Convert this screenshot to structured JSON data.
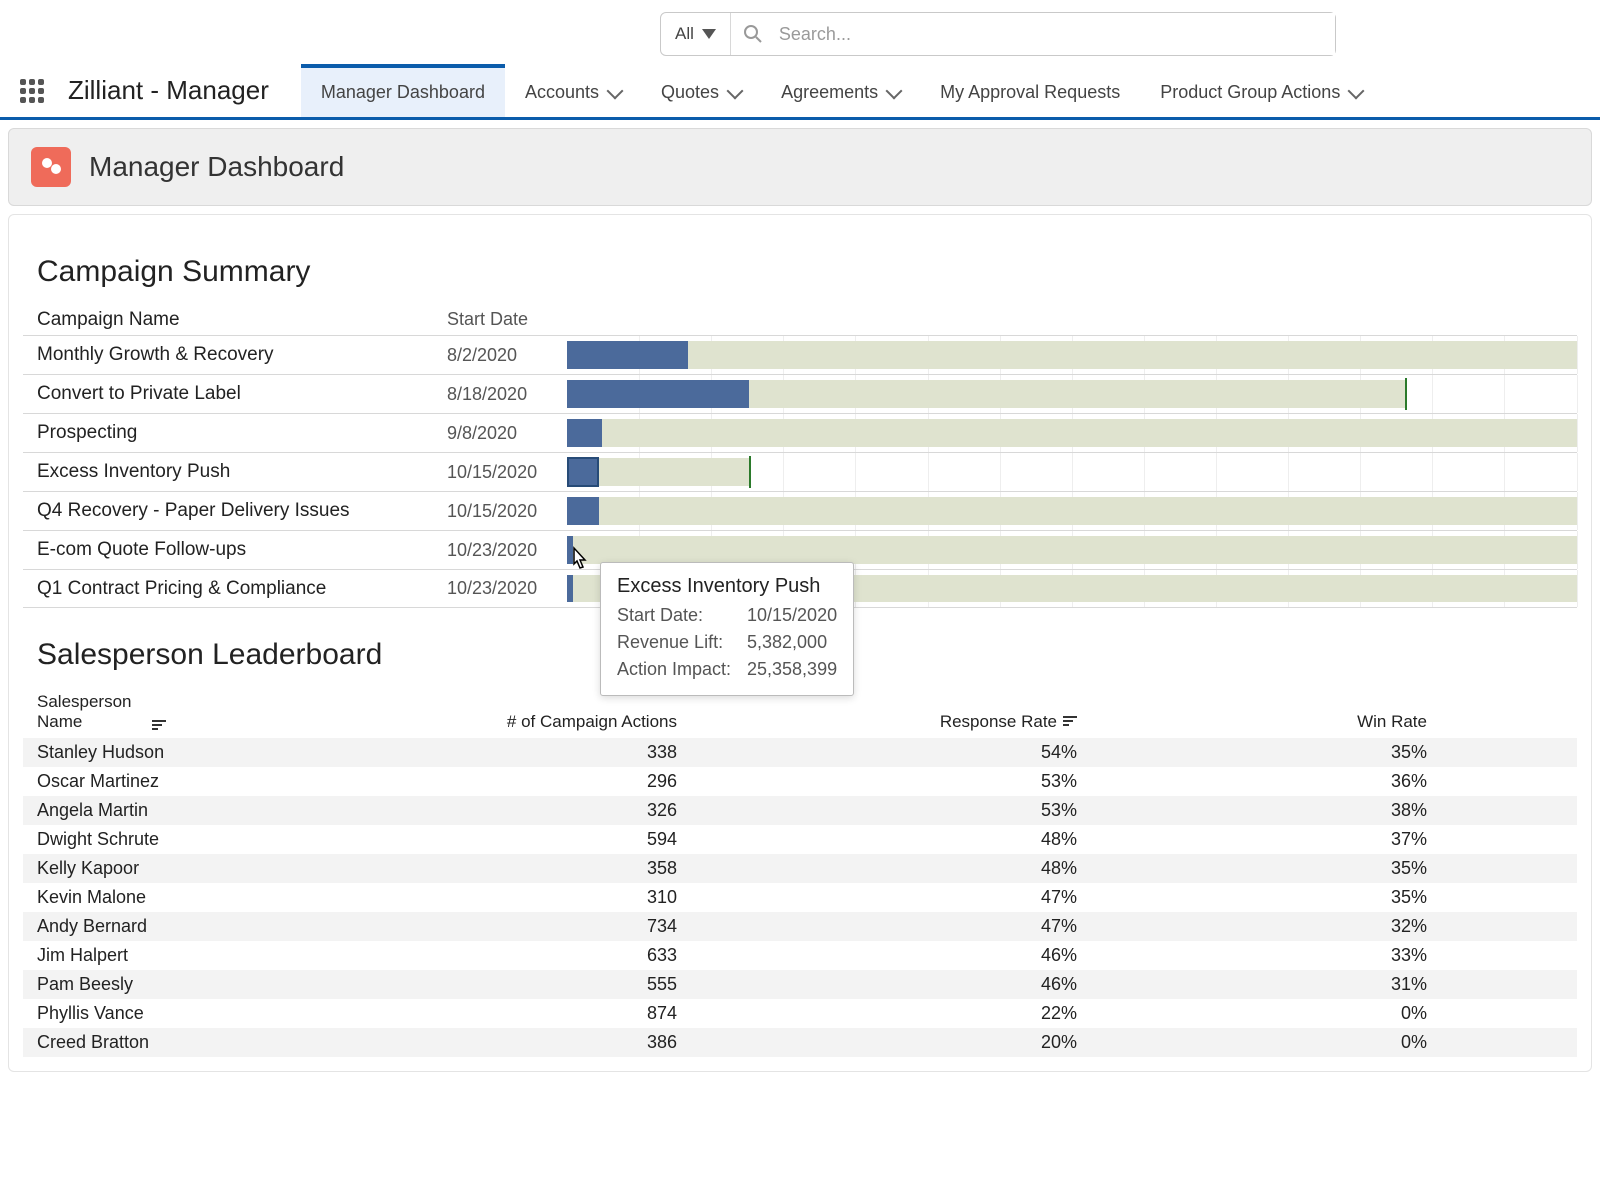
{
  "search": {
    "filter_label": "All",
    "placeholder": "Search..."
  },
  "app_name": "Zilliant - Manager",
  "nav": [
    {
      "label": "Manager Dashboard",
      "has_chev": false,
      "active": true
    },
    {
      "label": "Accounts",
      "has_chev": true,
      "active": false
    },
    {
      "label": "Quotes",
      "has_chev": true,
      "active": false
    },
    {
      "label": "Agreements",
      "has_chev": true,
      "active": false
    },
    {
      "label": "My Approval Requests",
      "has_chev": false,
      "active": false
    },
    {
      "label": "Product Group Actions",
      "has_chev": true,
      "active": false
    }
  ],
  "page_title": "Manager Dashboard",
  "campaign": {
    "title": "Campaign Summary",
    "col_name": "Campaign Name",
    "col_date": "Start Date",
    "rows": [
      {
        "name": "Monthly Growth & Recovery",
        "date": "8/2/2020",
        "bg": 100,
        "fg": 12,
        "tick": null,
        "sel": false
      },
      {
        "name": "Convert to Private Label",
        "date": "8/18/2020",
        "bg": 83,
        "fg": 18,
        "tick": 83,
        "sel": false
      },
      {
        "name": "Prospecting",
        "date": "9/8/2020",
        "bg": 100,
        "fg": 3.5,
        "tick": null,
        "sel": false
      },
      {
        "name": "Excess Inventory Push",
        "date": "10/15/2020",
        "bg": 18,
        "fg": 3.2,
        "tick": 18,
        "sel": true
      },
      {
        "name": "Q4 Recovery - Paper Delivery Issues",
        "date": "10/15/2020",
        "bg": 100,
        "fg": 3.2,
        "tick": null,
        "sel": false
      },
      {
        "name": "E-com Quote Follow-ups",
        "date": "10/23/2020",
        "bg": 100,
        "fg": 0.6,
        "tick": null,
        "sel": false
      },
      {
        "name": "Q1 Contract Pricing & Compliance",
        "date": "10/23/2020",
        "bg": 100,
        "fg": 0.6,
        "tick": null,
        "sel": false
      }
    ]
  },
  "tooltip": {
    "title": "Excess Inventory Push",
    "rows": [
      {
        "label": "Start Date:",
        "value": "10/15/2020"
      },
      {
        "label": "Revenue Lift:",
        "value": "5,382,000"
      },
      {
        "label": "Action Impact:",
        "value": "25,358,399"
      }
    ]
  },
  "leaderboard": {
    "title": "Salesperson Leaderboard",
    "col_name_l1": "Salesperson",
    "col_name_l2": "Name",
    "col_actions": "# of Campaign Actions",
    "col_resp": "Response Rate",
    "col_win": "Win Rate",
    "rows": [
      {
        "name": "Stanley Hudson",
        "actions": "338",
        "resp": "54%",
        "win": "35%"
      },
      {
        "name": "Oscar Martinez",
        "actions": "296",
        "resp": "53%",
        "win": "36%"
      },
      {
        "name": "Angela Martin",
        "actions": "326",
        "resp": "53%",
        "win": "38%"
      },
      {
        "name": "Dwight Schrute",
        "actions": "594",
        "resp": "48%",
        "win": "37%"
      },
      {
        "name": "Kelly Kapoor",
        "actions": "358",
        "resp": "48%",
        "win": "35%"
      },
      {
        "name": "Kevin Malone",
        "actions": "310",
        "resp": "47%",
        "win": "35%"
      },
      {
        "name": "Andy Bernard",
        "actions": "734",
        "resp": "47%",
        "win": "32%"
      },
      {
        "name": "Jim Halpert",
        "actions": "633",
        "resp": "46%",
        "win": "33%"
      },
      {
        "name": "Pam Beesly",
        "actions": "555",
        "resp": "46%",
        "win": "31%"
      },
      {
        "name": "Phyllis Vance",
        "actions": "874",
        "resp": "22%",
        "win": "0%"
      },
      {
        "name": "Creed Bratton",
        "actions": "386",
        "resp": "20%",
        "win": "0%"
      }
    ]
  },
  "chart_data": {
    "type": "bar",
    "title": "Campaign Summary",
    "categories": [
      "Monthly Growth & Recovery",
      "Convert to Private Label",
      "Prospecting",
      "Excess Inventory Push",
      "Q4 Recovery - Paper Delivery Issues",
      "E-com Quote Follow-ups",
      "Q1 Contract Pricing & Compliance"
    ],
    "series": [
      {
        "name": "Action Impact (background)",
        "values": [
          100,
          83,
          100,
          18,
          100,
          100,
          100
        ]
      },
      {
        "name": "Revenue Lift (foreground)",
        "values": [
          12,
          18,
          3.5,
          3.2,
          3.2,
          0.6,
          0.6
        ]
      }
    ],
    "note": "Values are relative bar lengths as percent of track width; tooltip shows Excess Inventory Push Revenue Lift 5,382,000 and Action Impact 25,358,399"
  }
}
